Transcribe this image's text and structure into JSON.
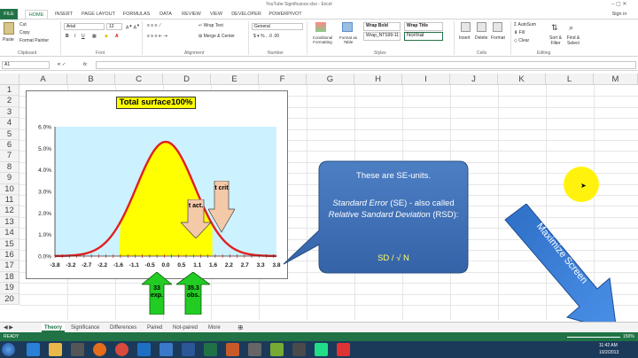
{
  "window": {
    "title": "YouTube Significance.xlsx - Excel",
    "sign_in": "Sign in"
  },
  "tabs": [
    "FILE",
    "HOME",
    "INSERT",
    "PAGE LAYOUT",
    "FORMULAS",
    "DATA",
    "REVIEW",
    "VIEW",
    "DEVELOPER",
    "POWERPIVOT"
  ],
  "ribbon": {
    "paste": "Paste",
    "cut": "Cut",
    "copy": "Copy",
    "format_painter": "Format Painter",
    "clipboard": "Clipboard",
    "font_name": "Arial",
    "font_size": "12",
    "font": "Font",
    "wrap_text": "Wrap Text",
    "merge_center": "Merge & Center",
    "alignment": "Alignment",
    "number_format": "General",
    "number": "Number",
    "conditional": "Conditional Formatting",
    "format_as_table": "Format as Table",
    "style1": "Wrap Bold",
    "style2": "Wrap Title",
    "style3": "Wrap_NTS99-11",
    "style4": "Normal",
    "styles": "Styles",
    "insert": "Insert",
    "delete": "Delete",
    "format": "Format",
    "cells": "Cells",
    "autosum": "AutoSum",
    "fill": "Fill",
    "clear": "Clear",
    "sort_filter": "Sort & Filter",
    "find_select": "Find & Select",
    "editing": "Editing"
  },
  "name_box": "A1",
  "fx": "fx",
  "columns": [
    "A",
    "B",
    "C",
    "D",
    "E",
    "F",
    "G",
    "H",
    "I",
    "J",
    "K",
    "L",
    "M"
  ],
  "rows": [
    "1",
    "2",
    "3",
    "4",
    "5",
    "6",
    "7",
    "8",
    "9",
    "10",
    "11",
    "12",
    "13",
    "14",
    "15",
    "16",
    "17",
    "18",
    "19",
    "20"
  ],
  "chart": {
    "title_label": "Total surface",
    "title_value": "100%",
    "t_act": "t act.",
    "t_crit": "t crit",
    "exp_label": "33 exp.",
    "obs_label": "35.3 obs."
  },
  "chart_data": {
    "type": "area",
    "title": "Total surface 100%",
    "x_ticks": [
      "-3.8",
      "-3.2",
      "-2.7",
      "-2.2",
      "-1.6",
      "-1.1",
      "-0.5",
      "0.0",
      "0.5",
      "1.1",
      "1.6",
      "2.2",
      "2.7",
      "3.3",
      "3.8"
    ],
    "y_ticks": [
      "0.0%",
      "1.0%",
      "2.0%",
      "3.0%",
      "4.0%",
      "5.0%",
      "6.0%"
    ],
    "xlim": [
      -3.8,
      3.8
    ],
    "ylim": [
      0,
      6
    ],
    "curve": "normal distribution, peak ~5.3% at x=0",
    "shaded_region": [
      -1.6,
      1.6
    ],
    "curve_color": "#e02020",
    "fill_color": "#ffff00",
    "plot_bg": "#ccf2ff"
  },
  "callout": {
    "line1": "These are SE-units.",
    "line2a": "Standard Error",
    "line2b": " (SE) - also called ",
    "line2c": "Relative Sandard Deviation",
    "line2d": " (RSD):",
    "formula": "SD /  √ N"
  },
  "maximize": "Maximize Screen",
  "sheet_tabs": [
    "Theory",
    "Significance",
    "Differences",
    "Paired",
    "Not-paired",
    "More"
  ],
  "status": {
    "ready": "READY",
    "zoom": "150%"
  },
  "clock": {
    "time": "11:42 AM",
    "date": "10/2/2013"
  }
}
